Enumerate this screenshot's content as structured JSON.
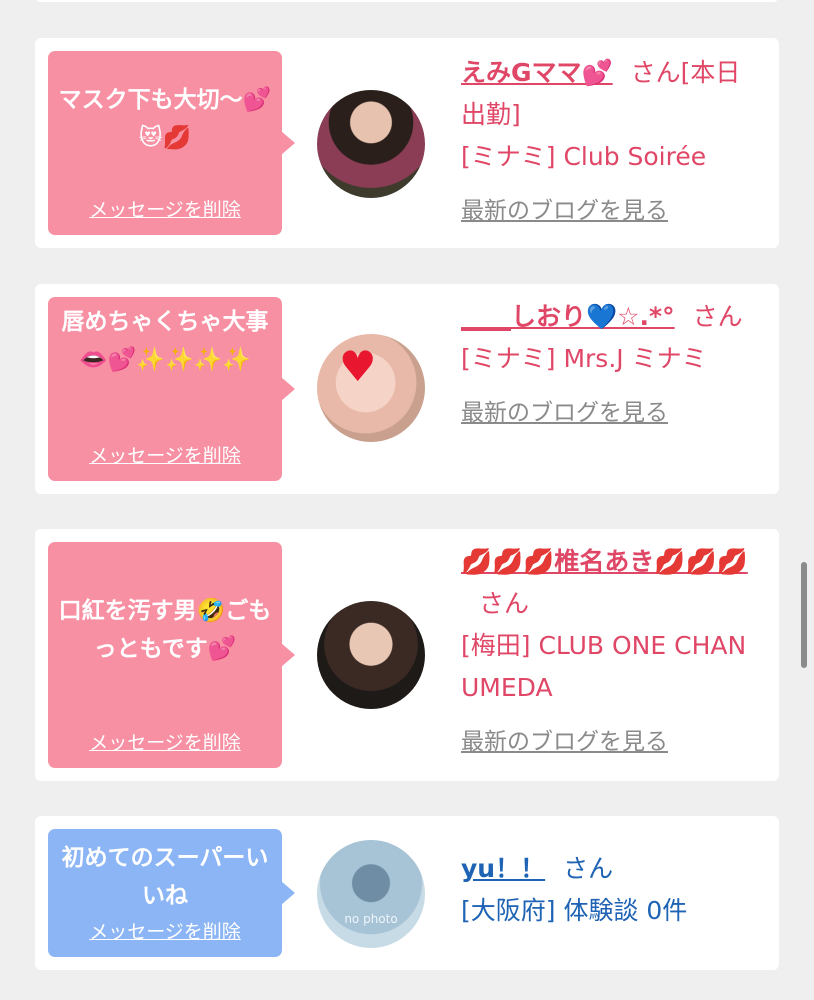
{
  "delete_label": "メッセージを削除",
  "blog_label": "最新のブログを見る",
  "cards": [
    {
      "message": "マスク下も大切〜💕😻💋",
      "name": "えみGママ💕",
      "suffix": "さん[本日出勤]",
      "shop": "[ミナミ] Club Soirée"
    },
    {
      "message": "唇めちゃくちゃ大事👄💕✨✨✨✨",
      "name": "____しおり💙☆.*°",
      "suffix": "さん",
      "shop": "[ミナミ] Mrs.J ミナミ",
      "avatar_overlay": "♥"
    },
    {
      "message": "口紅を汚す男🤣ごもっともです💕",
      "name": "💋💋💋椎名あき💋💋💋",
      "suffix": "さん",
      "shop": "[梅田] CLUB ONE CHAN UMEDA"
    },
    {
      "message": "初めてのスーパーいいね",
      "name": "yu！！",
      "suffix": "さん",
      "shop": "[大阪府] 体験談 0件",
      "avatar_text": "no photo"
    }
  ],
  "colors": {
    "pink_bubble": "#f890a3",
    "blue_bubble": "#8cb5f5",
    "pink_text": "#e04767",
    "blue_text": "#1e63b4",
    "background": "#efefef"
  }
}
